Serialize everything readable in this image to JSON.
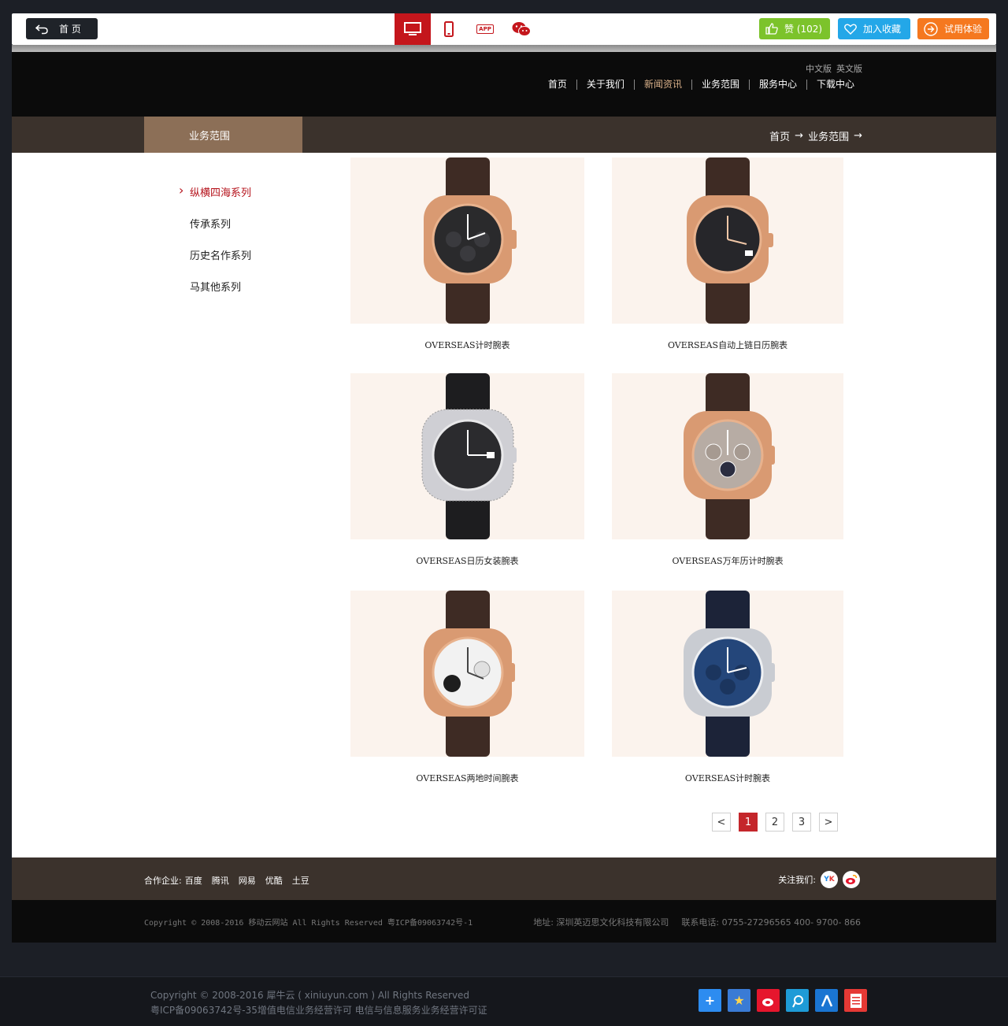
{
  "toolbar": {
    "home_label": "首 页",
    "like_label": "赞 (102)",
    "favorite_label": "加入收藏",
    "trial_label": "试用体验",
    "app_label": "APP"
  },
  "header": {
    "lang_cn": "中文版",
    "lang_en": "英文版",
    "nav": [
      "首页",
      "关于我们",
      "新闻资讯",
      "业务范围",
      "服务中心",
      "下载中心"
    ]
  },
  "section": {
    "title": "业务范围",
    "crumb_home": "首页",
    "crumb_current": "业务范围",
    "arrow": "→"
  },
  "sidebar": {
    "items": [
      "纵横四海系列",
      "传承系列",
      "历史名作系列",
      "马其他系列"
    ]
  },
  "products": [
    {
      "name": "OVERSEAS计时腕表"
    },
    {
      "name": "OVERSEAS自动上链日历腕表"
    },
    {
      "name": "OVERSEAS日历女装腕表"
    },
    {
      "name": "OVERSEAS万年历计时腕表"
    },
    {
      "name": "OVERSEAS两地时间腕表"
    },
    {
      "name": "OVERSEAS计时腕表"
    }
  ],
  "pager": {
    "prev": "<",
    "pages": [
      "1",
      "2",
      "3"
    ],
    "next": ">",
    "current": "1"
  },
  "footer": {
    "partners_label": "合作企业:",
    "partners": [
      "百度",
      "腾讯",
      "网易",
      "优酷",
      "土豆"
    ],
    "follow_label": "关注我们:",
    "copyright": "Copyright © 2008-2016 移动云网站 All Rights Reserved  粤ICP备09063742号-1",
    "address": "地址: 深圳英迈思文化科技有限公司",
    "phone": "联系电话: 0755-27296565 400- 9700- 866"
  },
  "page_footer": {
    "line1": "Copyright © 2008-2016 犀牛云 ( xiniuyun.com ) All Rights Reserved",
    "line2": "粤ICP备09063742号-35增值电信业务经营许可 电信与信息服务业务经营许可证"
  },
  "colors": {
    "accent": "#c4161c",
    "brown": "#3b322c",
    "tab": "#8c6f57",
    "nav_active": "#d9b089"
  }
}
